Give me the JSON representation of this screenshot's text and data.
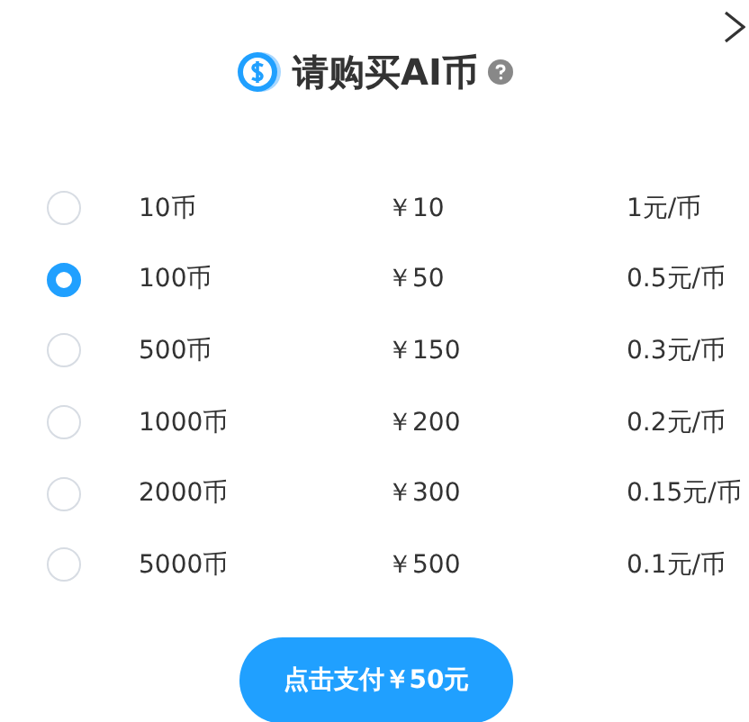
{
  "title": "请购买AI币",
  "options": [
    {
      "coins": "10币",
      "price": "￥10",
      "rate": "1元/币",
      "selected": false
    },
    {
      "coins": "100币",
      "price": "￥50",
      "rate": "0.5元/币",
      "selected": true
    },
    {
      "coins": "500币",
      "price": "￥150",
      "rate": "0.3元/币",
      "selected": false
    },
    {
      "coins": "1000币",
      "price": "￥200",
      "rate": "0.2元/币",
      "selected": false
    },
    {
      "coins": "2000币",
      "price": "￥300",
      "rate": "0.15元/币",
      "selected": false
    },
    {
      "coins": "5000币",
      "price": "￥500",
      "rate": "0.1元/币",
      "selected": false
    }
  ],
  "pay_button": "点击支付￥50元"
}
